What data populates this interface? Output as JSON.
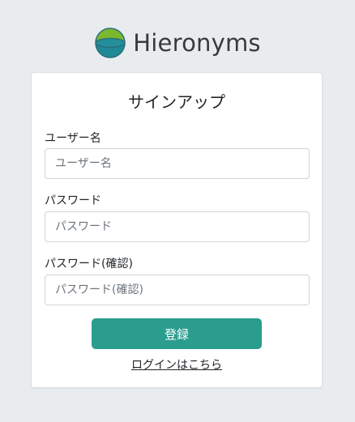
{
  "brand": {
    "name": "Hieronyms",
    "logo_icon": "hieronyms-logo-icon",
    "colors": {
      "logo_top": "#7cb82f",
      "logo_bottom": "#1f8a96",
      "logo_rim": "#2a6f78"
    }
  },
  "signup": {
    "title": "サインアップ",
    "username": {
      "label": "ユーザー名",
      "placeholder": "ユーザー名",
      "value": ""
    },
    "password": {
      "label": "パスワード",
      "placeholder": "パスワード",
      "value": ""
    },
    "password_confirm": {
      "label": "パスワード(確認)",
      "placeholder": "パスワード(確認)",
      "value": ""
    },
    "submit_label": "登録",
    "login_link": "ログインはこちら"
  },
  "theme": {
    "accent": "#2a9d8f",
    "background": "#e9ecef"
  }
}
